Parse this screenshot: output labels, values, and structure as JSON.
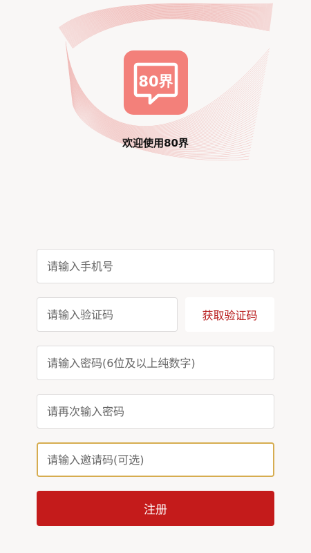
{
  "header": {
    "logo_text": "80界",
    "welcome": "欢迎使用80界"
  },
  "form": {
    "phone_placeholder": "请输入手机号",
    "code_placeholder": "请输入验证码",
    "get_code_label": "获取验证码",
    "password_placeholder": "请输入密码(6位及以上纯数字)",
    "confirm_password_placeholder": "请再次输入密码",
    "invite_placeholder": "请输入邀请码(可选)",
    "register_label": "注册"
  },
  "colors": {
    "logo_bg": "#f3807a",
    "accent_red": "#c41b1b",
    "focus_border": "#d6ac4f"
  }
}
